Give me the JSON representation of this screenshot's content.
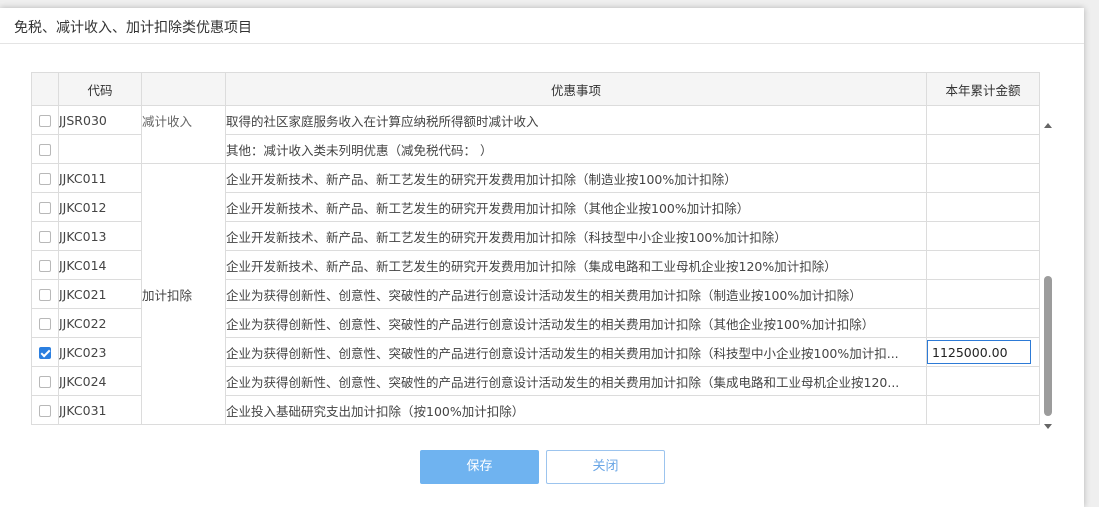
{
  "dialog": {
    "title": "免税、减计收入、加计扣除类优惠项目"
  },
  "table": {
    "headers": {
      "code": "代码",
      "item": "优惠事项",
      "amount": "本年累计金额"
    },
    "reduction_group": {
      "category_label_partial": "减计收入"
    },
    "rows": [
      {
        "code": "JJSR030",
        "item": "取得的社区家庭服务收入在计算应纳税所得额时减计收入",
        "checked": false,
        "amount": ""
      },
      {
        "code": "",
        "item": "其他：减计收入类未列明优惠（减免税代码：        ）",
        "checked": false,
        "amount": ""
      },
      {
        "code": "JJKC011",
        "item": "企业开发新技术、新产品、新工艺发生的研究开发费用加计扣除（制造业按100%加计扣除）",
        "checked": false,
        "amount": ""
      },
      {
        "code": "JJKC012",
        "item": "企业开发新技术、新产品、新工艺发生的研究开发费用加计扣除（其他企业按100%加计扣除）",
        "checked": false,
        "amount": ""
      },
      {
        "code": "JJKC013",
        "item": "企业开发新技术、新产品、新工艺发生的研究开发费用加计扣除（科技型中小企业按100%加计扣除）",
        "checked": false,
        "amount": ""
      },
      {
        "code": "JJKC014",
        "item": "企业开发新技术、新产品、新工艺发生的研究开发费用加计扣除（集成电路和工业母机企业按120%加计扣除）",
        "checked": false,
        "amount": ""
      },
      {
        "code": "JJKC021",
        "item": "企业为获得创新性、创意性、突破性的产品进行创意设计活动发生的相关费用加计扣除（制造业按100%加计扣除）",
        "checked": false,
        "amount": ""
      },
      {
        "code": "JJKC022",
        "item": "企业为获得创新性、创意性、突破性的产品进行创意设计活动发生的相关费用加计扣除（其他企业按100%加计扣除）",
        "checked": false,
        "amount": ""
      },
      {
        "code": "JJKC023",
        "item": "企业为获得创新性、创意性、突破性的产品进行创意设计活动发生的相关费用加计扣除（科技型中小企业按100%加计扣...",
        "checked": true,
        "amount": "1125000.00"
      },
      {
        "code": "JJKC024",
        "item": "企业为获得创新性、创意性、突破性的产品进行创意设计活动发生的相关费用加计扣除（集成电路和工业母机企业按120...",
        "checked": false,
        "amount": ""
      },
      {
        "code": "JJKC031",
        "item": "企业投入基础研究支出加计扣除（按100%加计扣除）",
        "checked": false,
        "amount": ""
      }
    ],
    "deduction_group": {
      "category_label": "加计扣除"
    }
  },
  "buttons": {
    "save": "保存",
    "close": "关闭"
  },
  "colors": {
    "accent": "#2b7fe0",
    "save_button": "#6fb3f0",
    "close_text": "#6aa6e6"
  }
}
